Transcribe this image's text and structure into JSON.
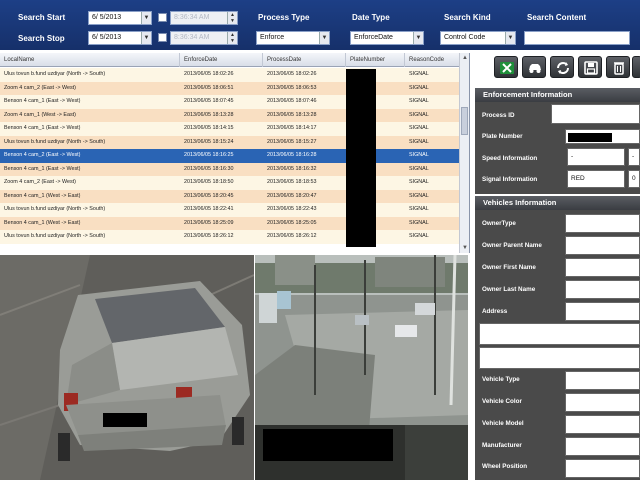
{
  "search": {
    "start_label": "Search Start",
    "stop_label": "Search Stop",
    "start_date": "6/ 5/2013",
    "stop_date": "6/ 5/2013",
    "start_time": "8:36:34 AM",
    "stop_time": "8:36:34 AM",
    "process_type_label": "Process Type",
    "process_type_value": "Enforce",
    "date_type_label": "Date Type",
    "date_type_value": "EnforceDate",
    "search_kind_label": "Search Kind",
    "search_kind_value": "Control Code",
    "search_content_label": "Search Content",
    "search_content_value": ""
  },
  "table": {
    "headers": [
      "LocalName",
      "EnforceDate",
      "ProcessDate",
      "PlateNumber",
      "ReasonCode"
    ],
    "rows": [
      {
        "local": "Ulus tovun b.fund uzdiyar (North -> South)",
        "enforce": "2013/06/05 18:02:26",
        "process": "2013/06/05 18:02:26",
        "reason": "SIGNAL"
      },
      {
        "local": "Zoom 4 cam_2 (East -> West)",
        "enforce": "2013/06/05 18:06:51",
        "process": "2013/06/05 18:06:53",
        "reason": "SIGNAL"
      },
      {
        "local": "Benson 4 cam_1 (East -> West)",
        "enforce": "2013/06/05 18:07:45",
        "process": "2013/06/05 18:07:46",
        "reason": "SIGNAL"
      },
      {
        "local": "Zoom 4 cam_1 (West -> East)",
        "enforce": "2013/06/05 18:13:28",
        "process": "2013/06/05 18:13:28",
        "reason": "SIGNAL"
      },
      {
        "local": "Benson 4 cam_1 (East -> West)",
        "enforce": "2013/06/05 18:14:15",
        "process": "2013/06/05 18:14:17",
        "reason": "SIGNAL"
      },
      {
        "local": "Ulus tovun b.fund uzdiyar (North -> South)",
        "enforce": "2013/06/05 18:15:24",
        "process": "2013/06/05 18:15:27",
        "reason": "SIGNAL"
      },
      {
        "local": "Benson 4 cam_2 (East -> West)",
        "enforce": "2013/06/05 18:16:25",
        "process": "2013/06/05 18:16:28",
        "reason": "SIGNAL"
      },
      {
        "local": "Benson 4 cam_1 (East -> West)",
        "enforce": "2013/06/05 18:16:30",
        "process": "2013/06/05 18:16:32",
        "reason": "SIGNAL"
      },
      {
        "local": "Zoom 4 cam_2 (East -> West)",
        "enforce": "2013/06/05 18:18:50",
        "process": "2013/06/05 18:18:53",
        "reason": "SIGNAL"
      },
      {
        "local": "Benson 4 cam_1 (West -> East)",
        "enforce": "2013/06/05 18:20:45",
        "process": "2013/06/05 18:20:47",
        "reason": "SIGNAL"
      },
      {
        "local": "Ulus tovun b.fund uzdiyar (North -> South)",
        "enforce": "2013/06/05 18:22:41",
        "process": "2013/06/05 18:22:43",
        "reason": "SIGNAL"
      },
      {
        "local": "Benson 4 cam_1 (West -> East)",
        "enforce": "2013/06/05 18:25:09",
        "process": "2013/06/05 18:25:05",
        "reason": "SIGNAL"
      },
      {
        "local": "Ulus tovun b.fund uzdiyar (North -> South)",
        "enforce": "2013/06/05 18:26:12",
        "process": "2013/06/05 18:26:12",
        "reason": "SIGNAL"
      }
    ],
    "selected_index": 6
  },
  "panel": {
    "enforcement_title": "Enforcement Information",
    "process_id_label": "Process ID",
    "plate_number_label": "Plate Number",
    "speed_info_label": "Speed Information",
    "speed_value": "-",
    "speed_value2": "-",
    "signal_info_label": "Signal Information",
    "signal_value": "RED",
    "signal_value2": "0",
    "vehicles_title": "Vehicles Information",
    "owner_type_label": "OwnerType",
    "owner_parent_label": "Owner Parent Name",
    "owner_first_label": "Owner First Name",
    "owner_last_label": "Owner Last Name",
    "address_label": "Address",
    "vehicle_type_label": "Vehicle Type",
    "vehicle_color_label": "Vehicle Color",
    "vehicle_model_label": "Vehicle Model",
    "manufacturer_label": "Manufacturer",
    "wheel_position_label": "Wheel Position"
  },
  "toolbar": {
    "icons": [
      "excel-icon",
      "car-icon",
      "refresh-icon",
      "save-icon",
      "delete-icon",
      "more-icon"
    ]
  },
  "colors": {
    "topbar": "#1d3f86",
    "row_even": "#fdf6e4",
    "row_odd": "#f9dfc2",
    "row_selected": "#2a64b4",
    "panel_dark": "#4a4a4a"
  }
}
